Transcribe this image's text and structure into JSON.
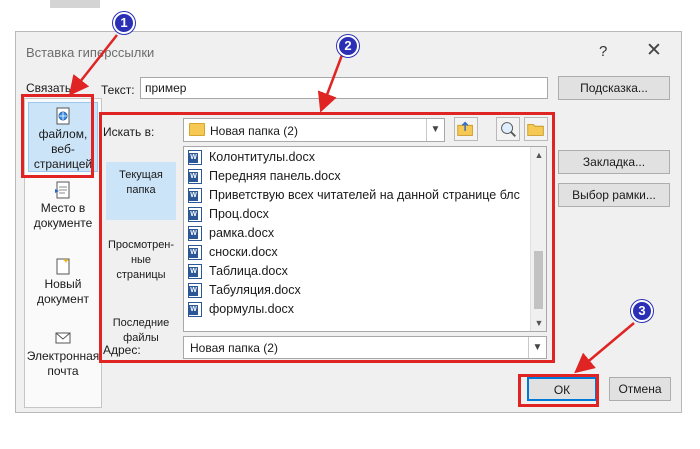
{
  "dialog": {
    "title": "Вставка гиперссылки",
    "help": "?",
    "close": "✕"
  },
  "link": {
    "label": "Связать",
    "items": [
      {
        "label": "файлом, веб-страницей",
        "icon": "web-file-icon"
      },
      {
        "label": "Место в документе",
        "icon": "document-place-icon"
      },
      {
        "label": "Новый документ",
        "icon": "new-document-icon"
      },
      {
        "label": "Электронная почта",
        "icon": "email-icon"
      }
    ]
  },
  "text_field": {
    "label": "Текст:",
    "value": "пример"
  },
  "hint_button": "Подсказка...",
  "look_in": {
    "label": "Искать в:",
    "value": "Новая папка (2)"
  },
  "nav": {
    "current": "Текущая папка",
    "browsed": "Просмотрен-ные страницы",
    "recent": "Последние файлы"
  },
  "files": [
    "Колонтитулы.docx",
    "Передняя панель.docx",
    "Приветствую всех читателей на данной странице блс",
    "Проц.docx",
    "рамка.docx",
    "сноски.docx",
    "Таблица.docx",
    "Табуляция.docx",
    "формулы.docx"
  ],
  "bookmark_button": "Закладка...",
  "frame_button": "Выбор рамки...",
  "address": {
    "label": "Адрес:",
    "value": "Новая папка (2)"
  },
  "ok_button": "ОК",
  "cancel_button": "Отмена",
  "markers": [
    "1",
    "2",
    "3"
  ],
  "colors": {
    "highlight": "#e02424",
    "marker": "#2a2fb5",
    "selection": "#cce4f7"
  }
}
